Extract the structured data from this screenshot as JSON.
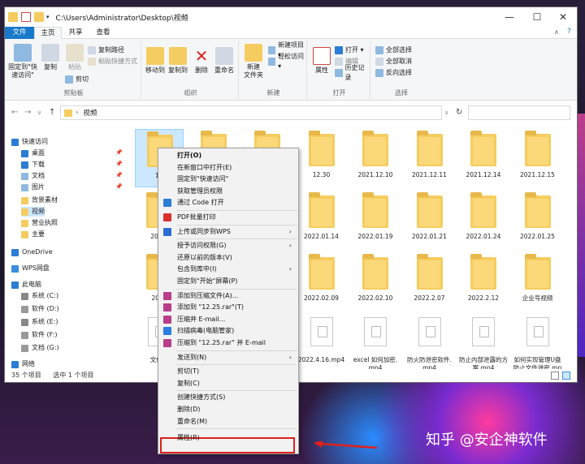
{
  "window": {
    "title_path": "C:\\Users\\Administrator\\Desktop\\视频",
    "controls": {
      "minimize": "—",
      "maximize": "☐",
      "close": "✕"
    }
  },
  "ribbon_tabs": [
    {
      "label": "文件",
      "active": true
    },
    {
      "label": "主页"
    },
    {
      "label": "共享"
    },
    {
      "label": "查看"
    }
  ],
  "ribbon": {
    "clipboard": {
      "pin": "固定到\"快\n速访问\"",
      "copy": "复制",
      "paste": "粘贴",
      "copy_path": "复制路径",
      "paste_shortcut": "粘贴快捷方式",
      "cut": "剪切",
      "label": "剪贴板"
    },
    "organize": {
      "move_to": "移动到",
      "copy_to": "复制到",
      "delete": "删除",
      "rename": "重命名",
      "label": "组织"
    },
    "new": {
      "new_folder": "新建\n文件夹",
      "new_item": "新建项目 ▾",
      "easy_access": "轻松访问 ▾",
      "label": "新建"
    },
    "open": {
      "properties": "属性",
      "open": "打开 ▾",
      "edit": "编辑",
      "history": "历史记录",
      "label": "打开"
    },
    "select": {
      "select_all": "全部选择",
      "select_none": "全部取消",
      "invert": "反向选择",
      "label": "选择"
    }
  },
  "address": {
    "crumb": "视频",
    "back": "←",
    "forward": "→",
    "down": "∨",
    "up": "↑",
    "refresh": "↻"
  },
  "nav": [
    {
      "label": "快速访问",
      "pinned": false
    },
    {
      "label": "桌面",
      "pinned": true
    },
    {
      "label": "下载",
      "pinned": true
    },
    {
      "label": "文档",
      "pinned": true
    },
    {
      "label": "图片",
      "pinned": true
    },
    {
      "label": "背景素材",
      "pinned": false
    },
    {
      "label": "视频",
      "pinned": false
    },
    {
      "label": "营业执照",
      "pinned": false
    },
    {
      "label": "主要",
      "pinned": false
    },
    {
      "label": "OneDrive",
      "pinned": false
    },
    {
      "label": "WPS网盘",
      "pinned": false
    },
    {
      "label": "此电脑",
      "pinned": false
    },
    {
      "label": "系统 (C:)",
      "pinned": false
    },
    {
      "label": "软件 (D:)",
      "pinned": false
    },
    {
      "label": "系统 (E:)",
      "pinned": false
    },
    {
      "label": "软件 (F:)",
      "pinned": false
    },
    {
      "label": "文档 (G:)",
      "pinned": false
    },
    {
      "label": "网络",
      "pinned": false
    }
  ],
  "pin_glyph": "📌",
  "files": [
    {
      "name": "12.",
      "type": "folder",
      "selected": true
    },
    {
      "name": "",
      "type": "folder"
    },
    {
      "name": "",
      "type": "folder"
    },
    {
      "name": "12.30",
      "type": "folder"
    },
    {
      "name": "2021.12.10",
      "type": "folder"
    },
    {
      "name": "2021.12.11",
      "type": "folder"
    },
    {
      "name": "2021.12.14",
      "type": "folder"
    },
    {
      "name": "2021.12.15",
      "type": "folder"
    },
    {
      "name": "2021.",
      "type": "folder"
    },
    {
      "name": "",
      "type": "folder"
    },
    {
      "name": "",
      "type": "folder"
    },
    {
      "name": "2022.01.14",
      "type": "folder"
    },
    {
      "name": "2022.01.19",
      "type": "folder"
    },
    {
      "name": "2022.01.21",
      "type": "folder"
    },
    {
      "name": "2022.01.24",
      "type": "folder"
    },
    {
      "name": "2022.01.25",
      "type": "folder"
    },
    {
      "name": "2022",
      "type": "folder"
    },
    {
      "name": "",
      "type": "folder"
    },
    {
      "name": "",
      "type": "folder"
    },
    {
      "name": "2022.02.09",
      "type": "folder"
    },
    {
      "name": "2022.02.10",
      "type": "folder"
    },
    {
      "name": "2022.2.07",
      "type": "folder"
    },
    {
      "name": "2022.2.12",
      "type": "folder"
    },
    {
      "name": "企业号视频",
      "type": "folder"
    },
    {
      "name": "文件加",
      "type": "doc"
    },
    {
      "name": "",
      "type": "doc"
    },
    {
      "name": "",
      "type": "doc"
    },
    {
      "name": "2022.4.16.mp4",
      "type": "doc"
    },
    {
      "name": "excel 如何加密.mp4",
      "type": "doc"
    },
    {
      "name": "防火防泄密软件.mp4",
      "type": "doc"
    },
    {
      "name": "防止内部泄露的方案.mp4",
      "type": "doc"
    },
    {
      "name": "如何实现管理U盘防止文件泄密.mp4",
      "type": "doc"
    }
  ],
  "status": {
    "count": "35 个项目",
    "selected": "选中 1 个项目"
  },
  "context_menu": [
    {
      "label": "打开(O)",
      "bold": true
    },
    {
      "label": "在新窗口中打开(E)"
    },
    {
      "label": "固定到\"快速访问\""
    },
    {
      "label": "获取管理员权限"
    },
    {
      "label": "通过 Code 打开",
      "icon": "#2b7cd3"
    },
    {
      "sep": true
    },
    {
      "label": "PDF批量打印",
      "icon": "#d9302c"
    },
    {
      "sep": true
    },
    {
      "label": "上传或同步到WPS",
      "icon": "#2b6cd6",
      "sub": true
    },
    {
      "sep": true
    },
    {
      "label": "授予访问权限(G)",
      "sub": true
    },
    {
      "label": "还原以前的版本(V)"
    },
    {
      "label": "包含到库中(I)",
      "sub": true
    },
    {
      "label": "固定到\"开始\"屏幕(P)"
    },
    {
      "sep": true
    },
    {
      "label": "添加到压缩文件(A)...",
      "icon": "#b83d8a"
    },
    {
      "label": "添加到 \"12.25.rar\"(T)",
      "icon": "#b83d8a"
    },
    {
      "label": "压缩并 E-mail...",
      "icon": "#b83d8a"
    },
    {
      "label": "扫描病毒(电脑管家)",
      "icon": "#2a7ee0"
    },
    {
      "label": "压缩到 \"12.25.rar\" 并 E-mail",
      "icon": "#b83d8a"
    },
    {
      "sep": true
    },
    {
      "label": "发送到(N)",
      "sub": true
    },
    {
      "sep": true
    },
    {
      "label": "剪切(T)"
    },
    {
      "label": "复制(C)"
    },
    {
      "sep": true
    },
    {
      "label": "创建快捷方式(S)"
    },
    {
      "label": "删除(D)"
    },
    {
      "label": "重命名(M)"
    },
    {
      "sep": true
    },
    {
      "label": "属性(R)",
      "highlight": true
    }
  ],
  "watermark": "知乎 @安企神软件",
  "colors": {
    "accent": "#1979ca",
    "folder": "#f5cc5f",
    "highlight": "#e0201c",
    "selection": "#cce8ff"
  }
}
